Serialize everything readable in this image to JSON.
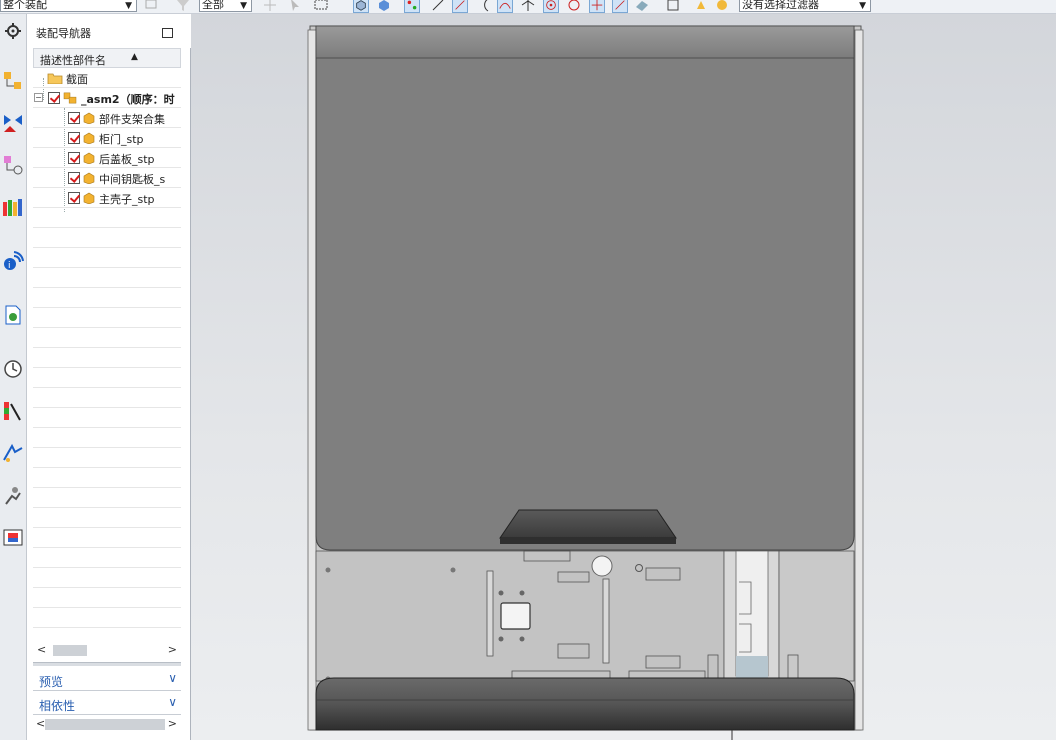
{
  "toolbar": {
    "scope_select": "整个装配",
    "type_select": "全部",
    "filter_select": "没有选择过滤器"
  },
  "navigator": {
    "title": "装配导航器",
    "column_header": "描述性部件名",
    "items": [
      {
        "label": "截面",
        "type": "folder"
      },
      {
        "label": "_asm2（顺序：时",
        "type": "assembly"
      },
      {
        "label": "部件支架合集",
        "type": "part"
      },
      {
        "label": "柜门_stp",
        "type": "part"
      },
      {
        "label": "后盖板_stp",
        "type": "part"
      },
      {
        "label": "中间钥匙板_s",
        "type": "part"
      },
      {
        "label": "主壳子_stp",
        "type": "part"
      }
    ],
    "sections": [
      {
        "label": "预览"
      },
      {
        "label": "相依性"
      }
    ]
  },
  "colors": {
    "check_red": "#d51a1a",
    "accordion_blue": "#2a5fb0",
    "viewport_bg": "#dcdfe3",
    "door_gray": "#7f7f7f",
    "handle_dark": "#4a4a4a"
  },
  "icons": [
    "settings-icon",
    "assembly-navigator-icon",
    "constraint-navigator-icon",
    "part-navigator-icon",
    "reuse-library-icon",
    "info-icon",
    "web-browser-icon",
    "history-icon",
    "visualization-icon",
    "process-icon",
    "roles-icon",
    "system-materials-icon"
  ]
}
